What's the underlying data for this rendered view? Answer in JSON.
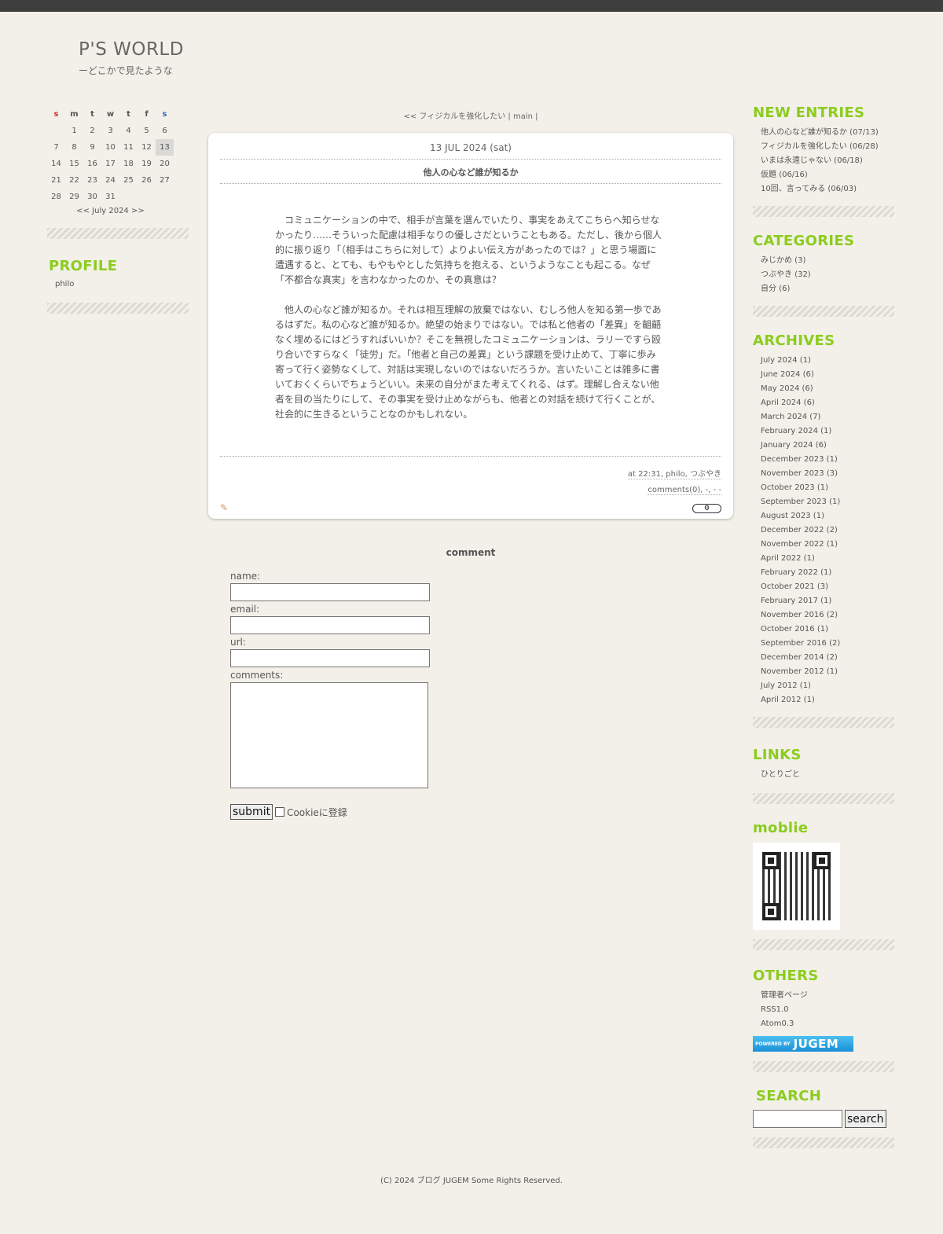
{
  "site": {
    "title": "P'S WORLD",
    "description": "ーどこかで見たような"
  },
  "calendar": {
    "weekdays": [
      "s",
      "m",
      "t",
      "w",
      "t",
      "f",
      "s"
    ],
    "weeks": [
      [
        "",
        "1",
        "2",
        "3",
        "4",
        "5",
        "6"
      ],
      [
        "7",
        "8",
        "9",
        "10",
        "11",
        "12",
        "13"
      ],
      [
        "14",
        "15",
        "16",
        "17",
        "18",
        "19",
        "20"
      ],
      [
        "21",
        "22",
        "23",
        "24",
        "25",
        "26",
        "27"
      ],
      [
        "28",
        "29",
        "30",
        "31",
        "",
        "",
        ""
      ]
    ],
    "today": "13",
    "nav": "<< July 2024 >>"
  },
  "profile": {
    "title": "PROFILE",
    "name": "philo"
  },
  "pager": "<< フィジカルを強化したい | main |",
  "entry": {
    "date": "13 JUL 2024 (sat)",
    "title": "他人の心など誰が知るか",
    "paragraphs": [
      "コミュニケーションの中で、相手が言葉を選んでいたり、事実をあえてこちらへ知らせなかったり……そういった配慮は相手なりの優しさだということもある。ただし、後から個人的に振り返り「（相手はこちらに対して）よりよい伝え方があったのでは？」と思う場面に遭遇すると、とても、もやもやとした気持ちを抱える、というようなことも起こる。なぜ「不都合な真実」を言わなかったのか、その真意は？",
      "他人の心など誰が知るか。それは相互理解の放棄ではない、むしろ他人を知る第一歩であるはずだ。私の心など誰が知るか。絶望の始まりではない。では私と他者の「差異」を齟齬なく埋めるにはどうすればいいか？そこを無視したコミュニケーションは、ラリーですら殴り合いですらなく「徒労」だ。「他者と自己の差異」という課題を受け止めて、丁寧に歩み寄って行く姿勢なくして、対話は実現しないのではないだろうか。言いたいことは雑多に書いておくくらいでちょうどいい。未来の自分がまた考えてくれる、はず。理解し合えない他者を目の当たりにして、その事実を受け止めながらも、他者との対話を続けて行くことが、社会的に生きるということなのかもしれない。"
    ],
    "meta_line1": "at 22:31, philo, つぶやき",
    "meta_line2": "comments(0), -, - -",
    "counter": "0"
  },
  "comment_form": {
    "heading": "comment",
    "name_label": "name:",
    "email_label": "email:",
    "url_label": "url:",
    "comments_label": "comments:",
    "submit_label": "submit",
    "cookie_label": "Cookieに登録"
  },
  "new_entries": {
    "title": "NEW ENTRIES",
    "items": [
      "他人の心など誰が知るか (07/13)",
      "フィジカルを強化したい (06/28)",
      "いまは永遠じゃない (06/18)",
      "仮題 (06/16)",
      "10回、言ってみる (06/03)"
    ]
  },
  "categories": {
    "title": "CATEGORIES",
    "items": [
      "みじかめ (3)",
      "つぶやき (32)",
      "自分 (6)"
    ]
  },
  "archives": {
    "title": "ARCHIVES",
    "items": [
      "July 2024 (1)",
      "June 2024 (6)",
      "May 2024 (6)",
      "April 2024 (6)",
      "March 2024 (7)",
      "February 2024 (1)",
      "January 2024 (6)",
      "December 2023 (1)",
      "November 2023 (3)",
      "October 2023 (1)",
      "September 2023 (1)",
      "August 2023 (1)",
      "December 2022 (2)",
      "November 2022 (1)",
      "April 2022 (1)",
      "February 2022 (1)",
      "October 2021 (3)",
      "February 2017 (1)",
      "November 2016 (2)",
      "October 2016 (1)",
      "September 2016 (2)",
      "December 2014 (2)",
      "November 2012 (1)",
      "July 2012 (1)",
      "April 2012 (1)"
    ]
  },
  "links": {
    "title": "LINKS",
    "items": [
      "ひとりごと"
    ]
  },
  "mobile": {
    "title": "moblie"
  },
  "others": {
    "title": "OTHERS",
    "items": [
      "管理者ページ",
      "RSS1.0",
      "Atom0.3"
    ],
    "badge_small": "POWERED BY",
    "badge_big": "JUGEM"
  },
  "search": {
    "title": "SEARCH",
    "button": "search"
  },
  "footer": "(C) 2024 ブログ JUGEM Some Rights Reserved."
}
